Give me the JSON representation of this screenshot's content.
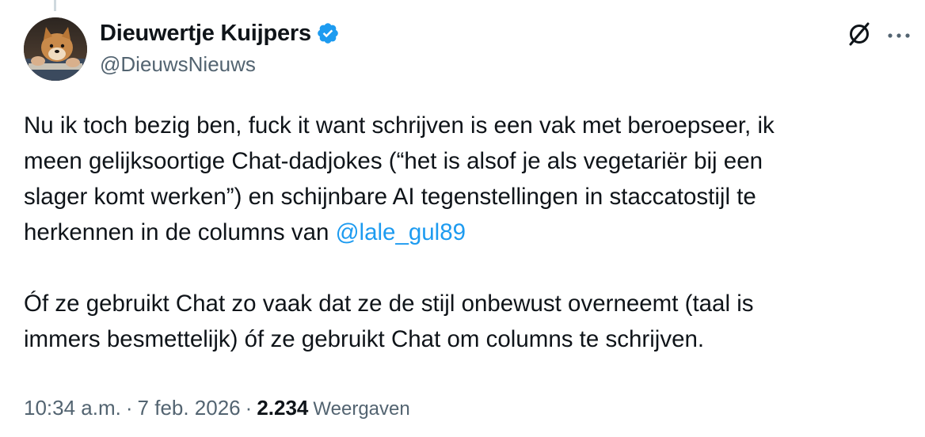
{
  "tweet": {
    "author": {
      "display_name": "Dieuwertje Kuijpers",
      "handle": "@DieuwsNieuws",
      "verified": true
    },
    "text_lines": [
      "Nu ik toch bezig ben, fuck it want schrijven is een vak met beroepseer, ik",
      "meen gelijksoortige Chat-dadjokes (“het is alsof je als vegetariër bij een",
      "slager komt werken”) en schijnbare AI tegenstellingen in staccatostijl te",
      "herkennen in de columns van ",
      "Óf ze gebruikt Chat zo vaak dat ze de stijl onbewust overneemt (taal is",
      "immers besmettelijk) óf ze gebruikt Chat om columns te schrijven."
    ],
    "mention": "@lale_gul89",
    "time": "10:34 a.m.",
    "separator": "·",
    "date": "7 feb. 2026",
    "views_count": "2.234",
    "views_label": "Weergaven"
  },
  "colors": {
    "text": "#0f1419",
    "secondary": "#536471",
    "accent": "#1d9bf0",
    "verified": "#1d9bf0"
  },
  "icons": {
    "grok": "grok-icon",
    "more": "more-icon",
    "verified": "verified-badge-icon"
  }
}
